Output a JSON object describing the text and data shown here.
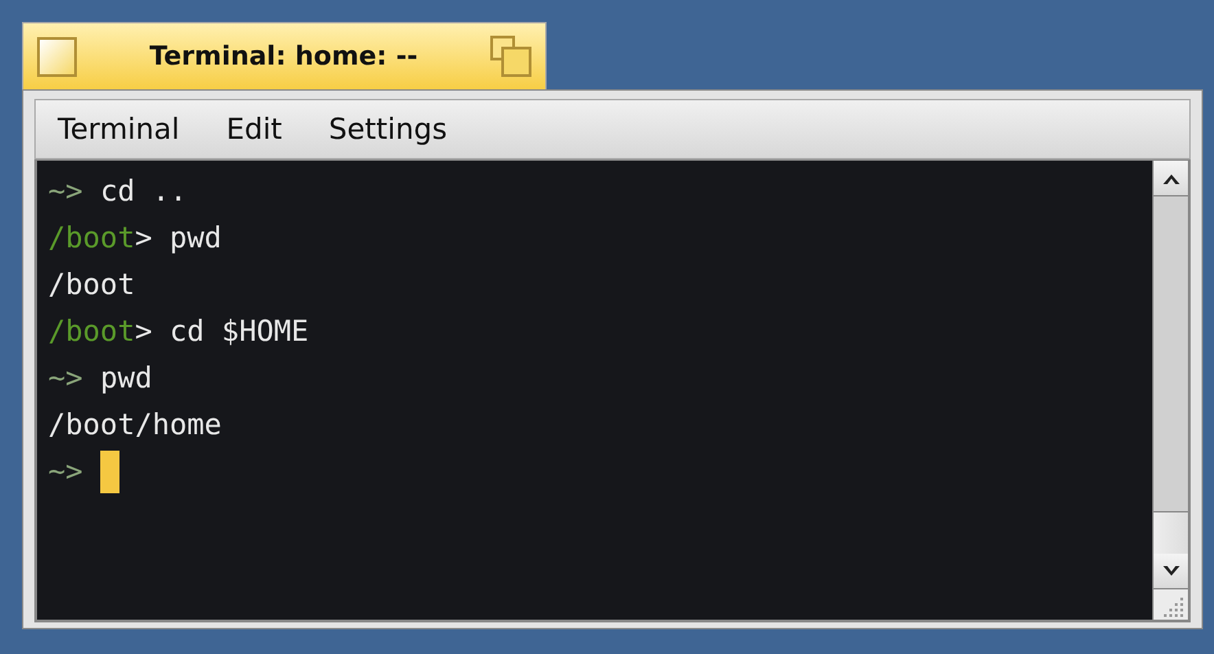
{
  "window": {
    "title": "Terminal: home: --",
    "active": true
  },
  "menu": [
    {
      "label": "Terminal"
    },
    {
      "label": "Edit"
    },
    {
      "label": "Settings"
    }
  ],
  "terminal": {
    "lines": [
      {
        "segments": [
          {
            "text": "~>",
            "kind": "prompt"
          },
          {
            "text": " cd ..",
            "kind": "plain"
          }
        ]
      },
      {
        "segments": [
          {
            "text": "/boot",
            "kind": "path"
          },
          {
            "text": "> pwd",
            "kind": "plain"
          }
        ]
      },
      {
        "segments": [
          {
            "text": "/boot",
            "kind": "plain"
          }
        ]
      },
      {
        "segments": [
          {
            "text": "/boot",
            "kind": "path"
          },
          {
            "text": "> cd $HOME",
            "kind": "plain"
          }
        ]
      },
      {
        "segments": [
          {
            "text": "~>",
            "kind": "prompt"
          },
          {
            "text": " pwd",
            "kind": "plain"
          }
        ]
      },
      {
        "segments": [
          {
            "text": "/boot/home",
            "kind": "plain"
          }
        ]
      },
      {
        "segments": [
          {
            "text": "~>",
            "kind": "prompt"
          }
        ],
        "cursor": true
      }
    ]
  }
}
